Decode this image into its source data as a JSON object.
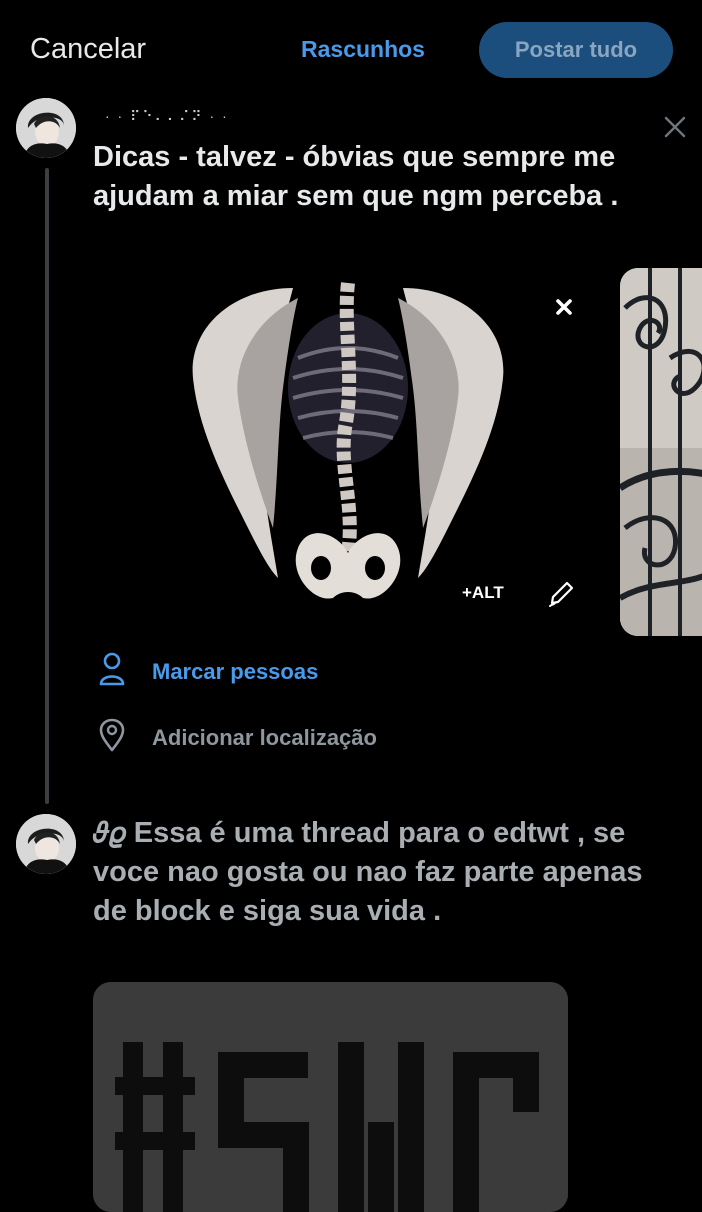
{
  "header": {
    "cancel_label": "Cancelar",
    "drafts_label": "Rascunhos",
    "post_all_label": "Postar tudo"
  },
  "tweet1": {
    "name_dots": "·  ·  ⠏⠑⠄⠄⠌⠝  ·  ·",
    "text": "Dicas - talvez - óbvias que sempre me ajudam a miar sem que ngm perceba .",
    "alt_label": "+ALT",
    "tag_people_label": "Marcar pessoas",
    "add_location_label": "Adicionar localização"
  },
  "tweet2": {
    "text": "𝜗𝜚 Essa é uma thread para o edtwt  ,  se voce nao gosta ou nao faz parte apenas de block e siga sua vida  ."
  },
  "colors": {
    "accent": "#4a9aea",
    "post_button_bg": "#1b4e7d",
    "background": "#000000",
    "thread_line": "#3b3f43"
  },
  "icons": [
    "close-icon",
    "remove-media-icon",
    "edit-media-icon",
    "person-icon",
    "location-pin-icon"
  ]
}
